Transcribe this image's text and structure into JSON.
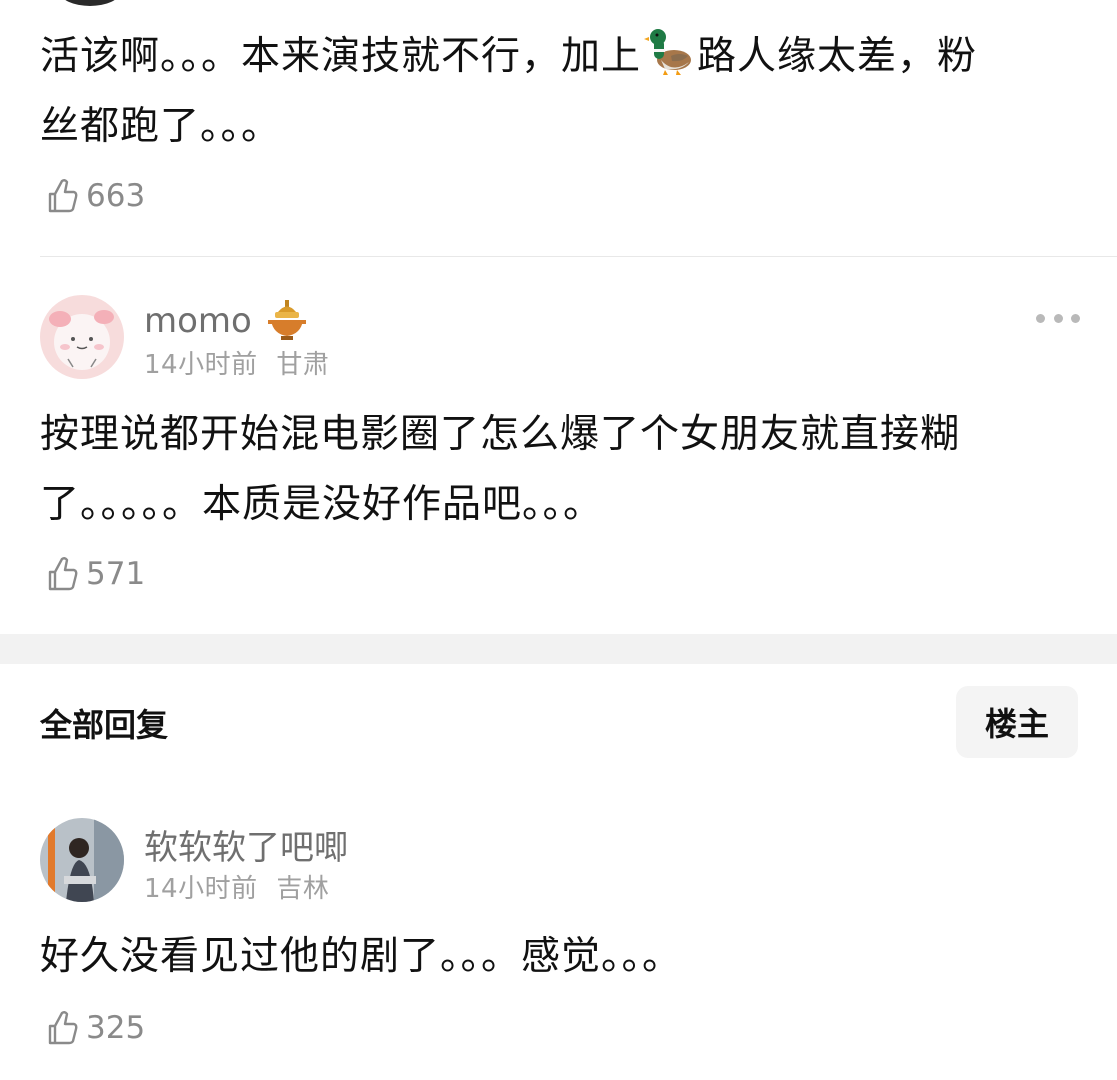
{
  "comments": [
    {
      "text_before_emoji": "活该啊。。。本来演技就不行，加上",
      "emoji": "duck-emoji",
      "text_after_emoji": "路人缘太差，粉",
      "text_line2": "丝都跑了。。。",
      "likes": "663"
    },
    {
      "username": "momo",
      "badge": "hotpot-badge",
      "time": "14小时前",
      "location": "甘肃",
      "text_line1": "按理说都开始混电影圈了怎么爆了个女朋友就直接糊",
      "text_line2": "了。。。。。本质是没好作品吧。。。",
      "likes": "571"
    }
  ],
  "replies_section": {
    "title": "全部回复",
    "filter_label": "楼主"
  },
  "replies": [
    {
      "username": "软软软了吧唧",
      "time": "14小时前",
      "location": "吉林",
      "text": "好久没看见过他的剧了。。。感觉。。。",
      "likes": "325"
    }
  ],
  "colors": {
    "text": "#111111",
    "muted": "#8a8a8a",
    "divider": "#e8e8e8",
    "section_bg": "#f2f2f2"
  },
  "icons": {
    "like": "thumbs-up-icon",
    "more": "more-dots-icon"
  }
}
